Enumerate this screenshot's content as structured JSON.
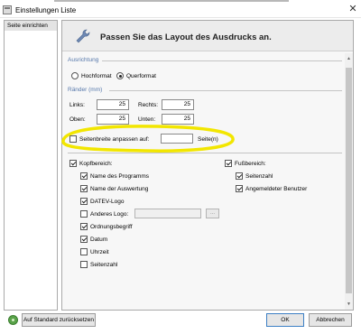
{
  "window": {
    "title": "Einstellungen Liste",
    "close_glyph": "✕"
  },
  "sidebar": {
    "items": [
      {
        "label": "Seite einrichten"
      }
    ]
  },
  "header": {
    "title": "Passen Sie das Layout des Ausdrucks an.",
    "icon": "wrench-icon"
  },
  "ausrichtung": {
    "heading": "Ausrichtung",
    "options": [
      {
        "label": "Hochformat",
        "selected": false
      },
      {
        "label": "Querformat",
        "selected": true
      }
    ]
  },
  "raender": {
    "heading": "Ränder (mm)",
    "links": {
      "label": "Links:",
      "value": "25"
    },
    "rechts": {
      "label": "Rechts:",
      "value": "25"
    },
    "oben": {
      "label": "Oben:",
      "value": "25"
    },
    "unten": {
      "label": "Unten:",
      "value": "25"
    }
  },
  "seitenbreite": {
    "label": "Seitenbreite anpassen auf:",
    "checked": false,
    "value": "",
    "unit": "Seite(n)",
    "highlight_color": "#f2e600"
  },
  "kopfbereich": {
    "label": "Kopfbereich:",
    "checked": true,
    "items": [
      {
        "label": "Name des Programms",
        "checked": true
      },
      {
        "label": "Name der Auswertung",
        "checked": true
      },
      {
        "label": "DATEV-Logo",
        "checked": true
      },
      {
        "label": "Anderes Logo:",
        "checked": false
      },
      {
        "label": "Ordnungsbegriff",
        "checked": true
      },
      {
        "label": "Datum",
        "checked": true
      },
      {
        "label": "Uhrzeit",
        "checked": false
      },
      {
        "label": "Seitenzahl",
        "checked": false
      }
    ],
    "browse_label": "..."
  },
  "fussbereich": {
    "label": "Fußbereich:",
    "checked": true,
    "items": [
      {
        "label": "Seitenzahl",
        "checked": true
      },
      {
        "label": "Angemeldeter Benutzer",
        "checked": true
      }
    ]
  },
  "footer": {
    "reset_label": "Auf Standard zurücksetzen",
    "ok_label": "OK",
    "cancel_label": "Abbrechen"
  }
}
